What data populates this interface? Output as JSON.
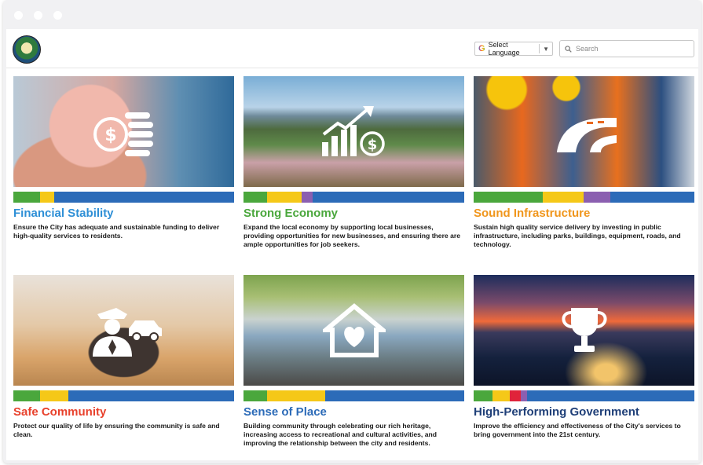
{
  "header": {
    "language_label": "Select Language",
    "language_arrow": "▼",
    "search_placeholder": "Search"
  },
  "cards": [
    {
      "title": "Financial Stability",
      "title_color": "#2e8fd6",
      "description": "Ensure the City has adequate and sustainable funding to deliver high-quality services to residents.",
      "icon": "piggy-bank-coins-icon",
      "colorbar": [
        "#4aa73c",
        "#f5c818",
        "#2c6bb8"
      ]
    },
    {
      "title": "Strong Economy",
      "title_color": "#4aa73c",
      "description": "Expand the local economy by supporting local businesses, providing opportunities for new businesses, and ensuring there are ample opportunities for job seekers.",
      "icon": "growth-chart-dollar-icon",
      "colorbar": [
        "#4aa73c",
        "#f5c818",
        "#8b5fb0",
        "#2c6bb8"
      ]
    },
    {
      "title": "Sound Infrastructure",
      "title_color": "#f0961c",
      "description": "Sustain high quality service delivery by investing in public infrastructure, including parks, buildings, equipment, roads, and technology.",
      "icon": "road-icon",
      "colorbar": [
        "#4aa73c",
        "#f5c818",
        "#8b5fb0",
        "#2c6bb8"
      ]
    },
    {
      "title": "Safe Community",
      "title_color": "#e8412c",
      "description": "Protect our quality of life by ensuring the community is safe and clean.",
      "icon": "police-officer-car-icon",
      "colorbar": [
        "#4aa73c",
        "#f5c818",
        "#2c6bb8"
      ]
    },
    {
      "title": "Sense of Place",
      "title_color": "#2c6bb8",
      "description": "Building community through celebrating our rich heritage, increasing access to recreational and cultural activities, and improving the relationship between the city and residents.",
      "icon": "house-heart-icon",
      "colorbar": [
        "#4aa73c",
        "#f5c818",
        "#2c6bb8"
      ]
    },
    {
      "title": "High-Performing Government",
      "title_color": "#1f3f78",
      "description": "Improve the efficiency and effectiveness of the City's services to bring government into the 21st century.",
      "icon": "trophy-icon",
      "colorbar": [
        "#4aa73c",
        "#f5c818",
        "#e0233a",
        "#8b5fb0",
        "#2c6bb8"
      ]
    }
  ]
}
